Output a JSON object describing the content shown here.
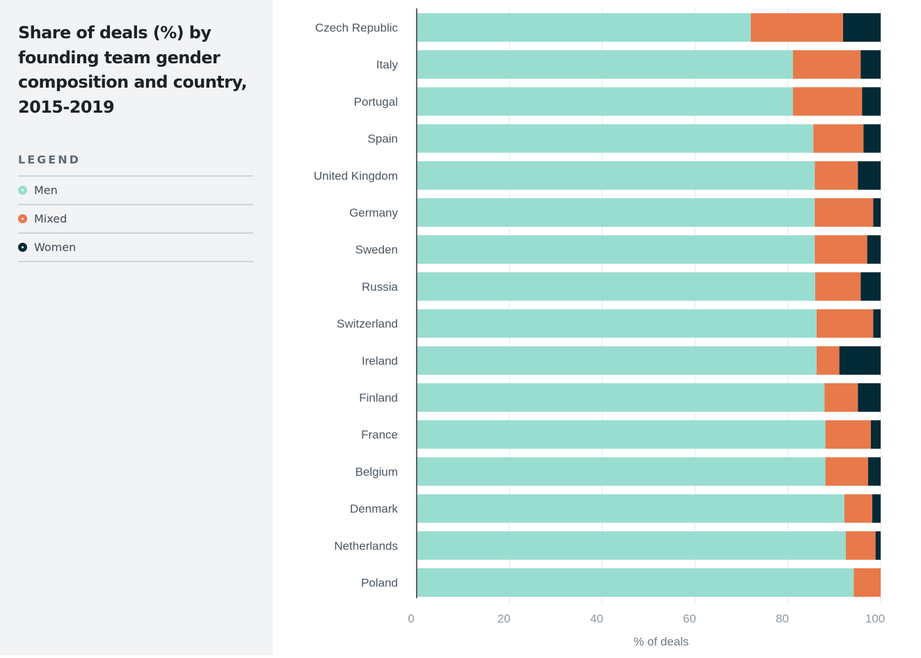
{
  "sidebar": {
    "title": "Share of deals (%) by founding team gender composition and country, 2015-2019",
    "legend_heading": "LEGEND",
    "legend": [
      {
        "label": "Men",
        "color": "#99ddd1",
        "icon": "circle-ring-icon"
      },
      {
        "label": "Mixed",
        "color": "#e8794a",
        "icon": "circle-ring-icon"
      },
      {
        "label": "Women",
        "color": "#022a36",
        "icon": "circle-ring-icon"
      }
    ]
  },
  "chart_data": {
    "type": "bar",
    "orientation": "horizontal",
    "stacked": true,
    "title": "Share of deals (%) by founding team gender composition and country, 2015-2019",
    "xlabel": "% of deals",
    "ylabel": "",
    "xlim": [
      0,
      100
    ],
    "xticks": [
      0,
      20,
      40,
      60,
      80,
      100
    ],
    "grid": true,
    "legend_position": "left-panel",
    "categories": [
      "Czech Republic",
      "Italy",
      "Portugal",
      "Spain",
      "United Kingdom",
      "Germany",
      "Sweden",
      "Russia",
      "Switzerland",
      "Ireland",
      "Finland",
      "France",
      "Belgium",
      "Denmark",
      "Netherlands",
      "Poland"
    ],
    "series": [
      {
        "name": "Men",
        "color": "#99ddd1",
        "values": [
          72.0,
          81.1,
          81.1,
          85.5,
          85.8,
          85.8,
          85.8,
          85.9,
          86.2,
          86.2,
          87.9,
          88.1,
          88.1,
          92.2,
          92.5,
          94.2
        ]
      },
      {
        "name": "Mixed",
        "color": "#e8794a",
        "values": [
          19.9,
          14.6,
          14.9,
          10.8,
          9.3,
          12.6,
          11.3,
          9.8,
          12.2,
          4.9,
          7.2,
          9.8,
          9.2,
          6.0,
          6.4,
          5.8
        ]
      },
      {
        "name": "Women",
        "color": "#022a36",
        "values": [
          8.1,
          4.3,
          4.0,
          3.7,
          4.9,
          1.6,
          2.9,
          4.3,
          1.6,
          8.9,
          4.9,
          2.1,
          2.7,
          1.8,
          1.1,
          0.0
        ]
      }
    ]
  }
}
